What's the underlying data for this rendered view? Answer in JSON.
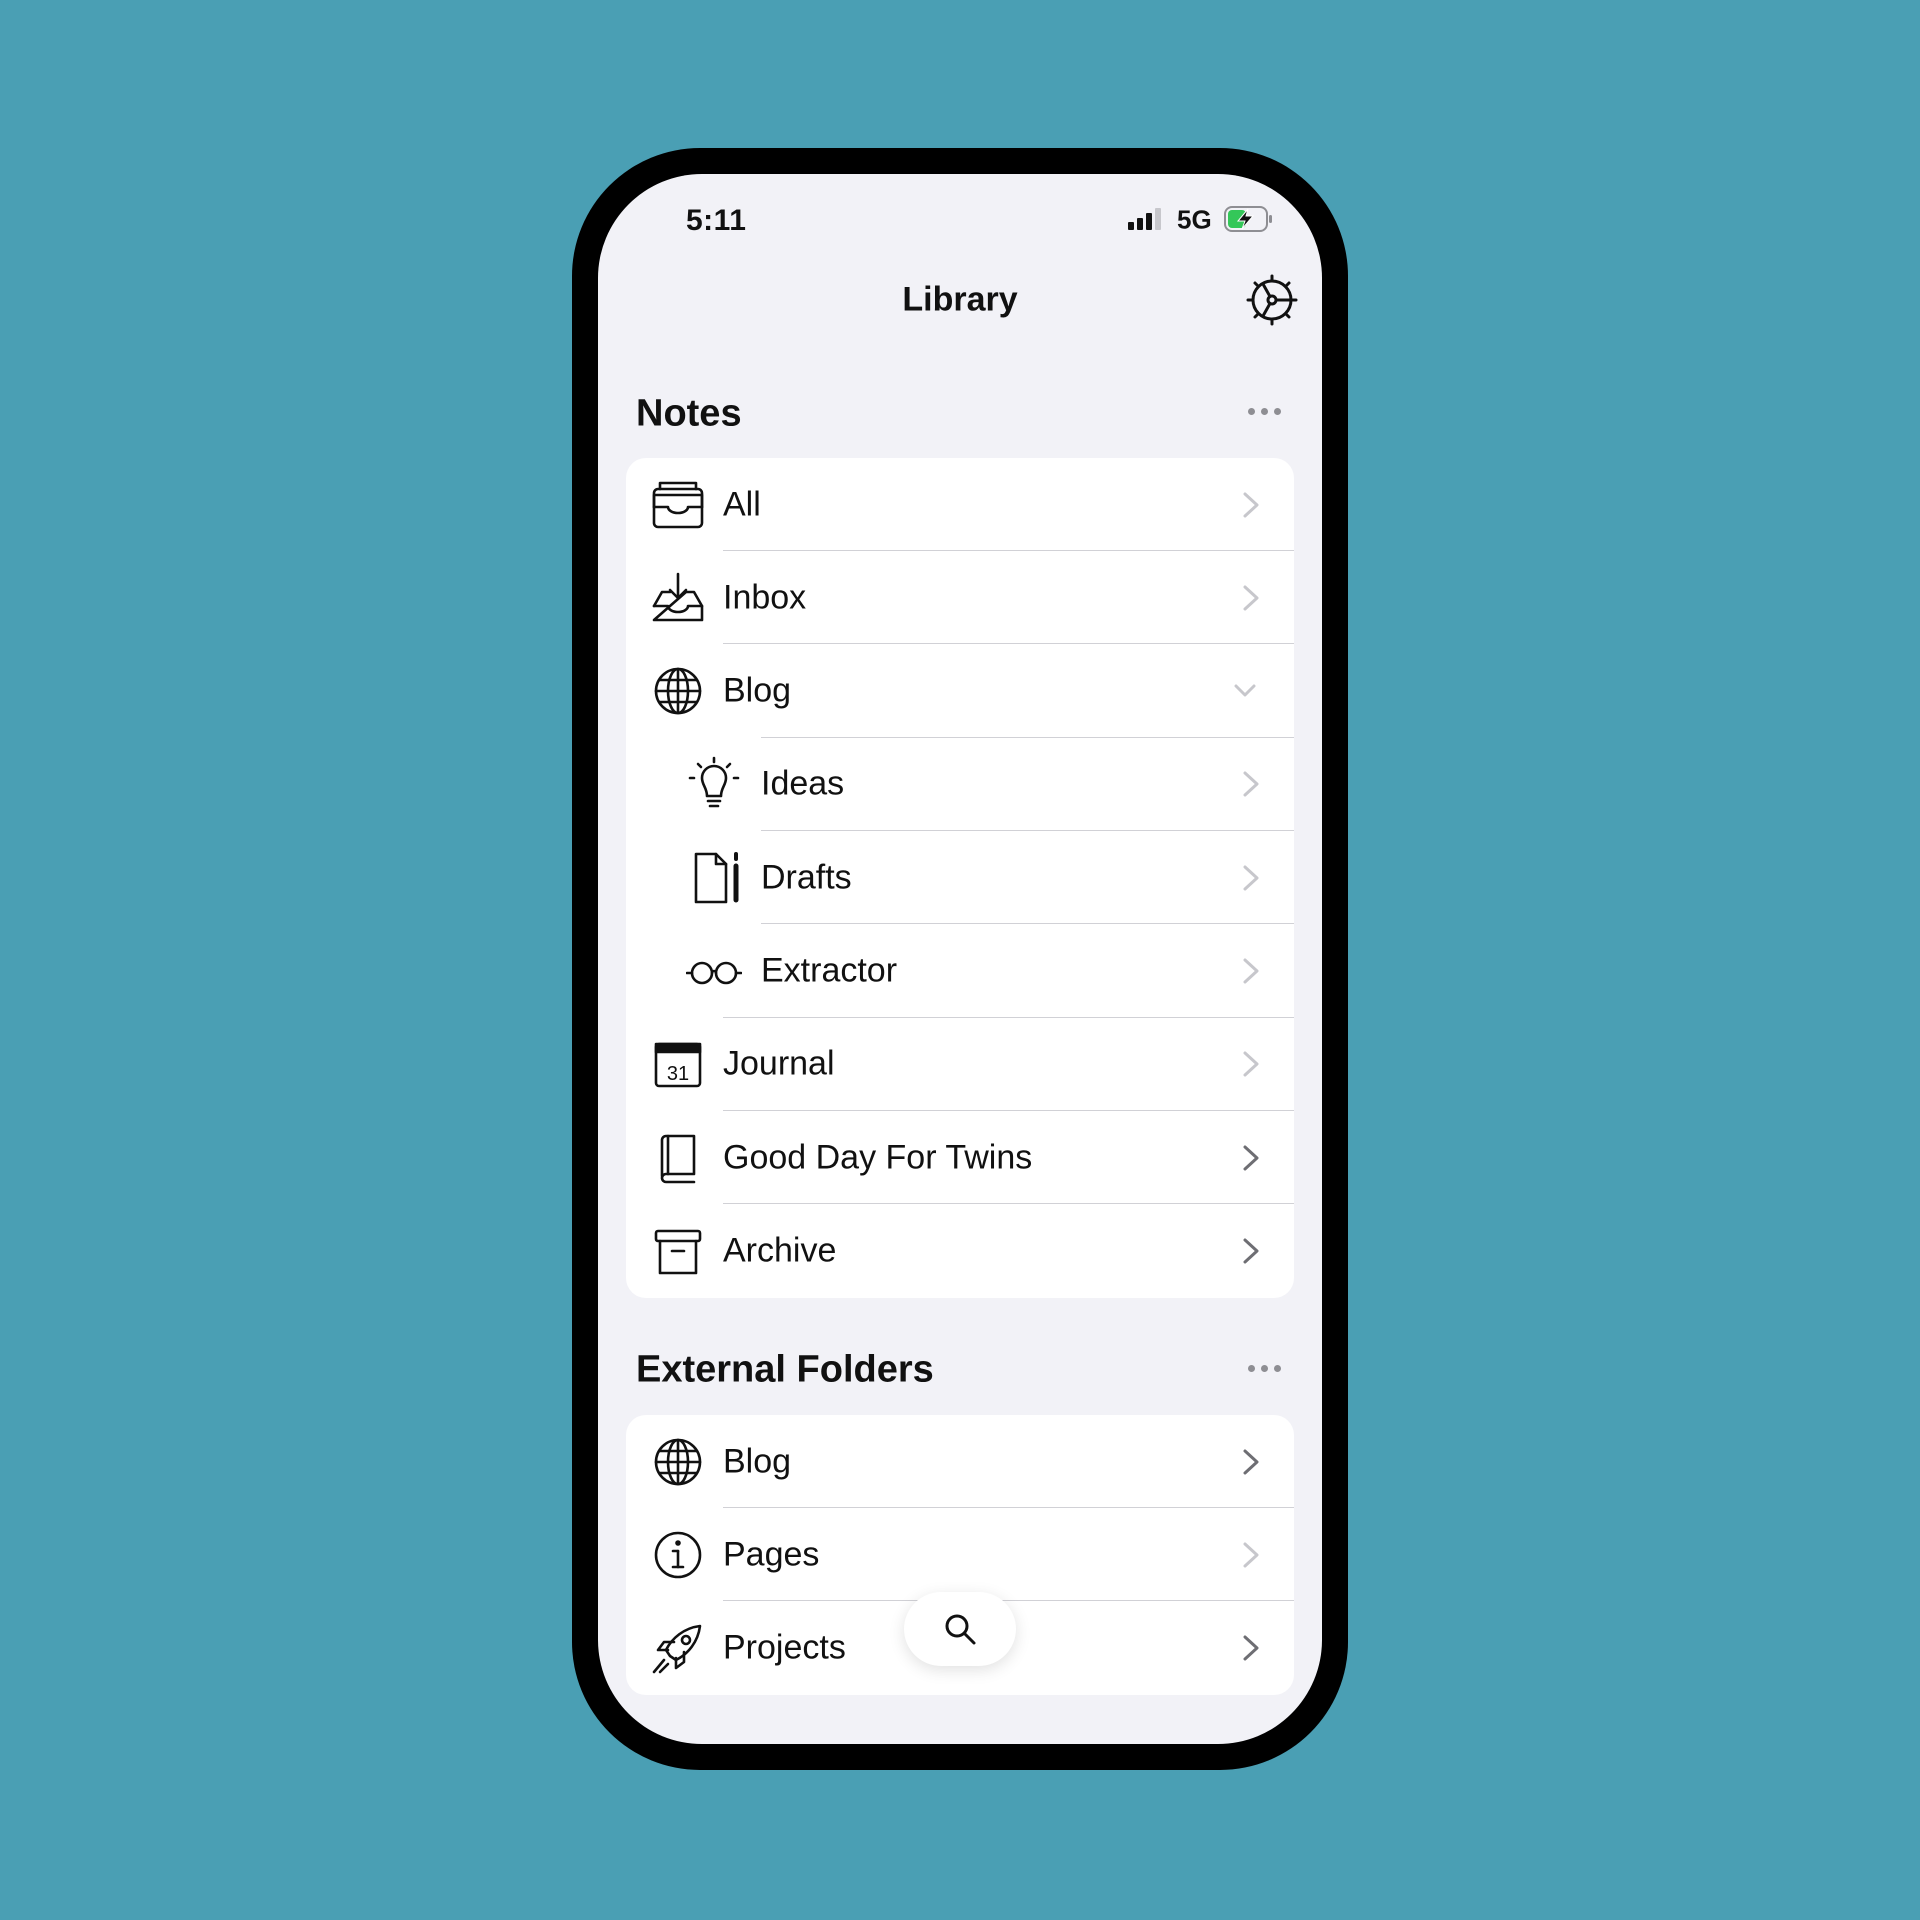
{
  "colors": {
    "background": "#4A9FB4",
    "screen": "#F2F2F7",
    "card": "#FFFFFF",
    "text": "#111111",
    "separator": "#D1D1D6",
    "chevron_muted": "#C7C7CC",
    "chevron_dark": "#6E6E73",
    "battery_green": "#34C759"
  },
  "status_bar": {
    "time": "5:11",
    "network": "5G",
    "signal_icon": "cellular-signal-icon",
    "battery_icon": "battery-charging-icon"
  },
  "nav": {
    "title": "Library",
    "settings_icon": "gear-icon"
  },
  "notes": {
    "title": "Notes",
    "more_icon": "ellipsis-icon",
    "items": [
      {
        "label": "All",
        "icon": "tray-stack-icon",
        "chevron": "right"
      },
      {
        "label": "Inbox",
        "icon": "inbox-download-icon",
        "chevron": "right"
      },
      {
        "label": "Blog",
        "icon": "globe-icon",
        "chevron": "down"
      },
      {
        "label": "Ideas",
        "icon": "lightbulb-icon",
        "chevron": "right"
      },
      {
        "label": "Drafts",
        "icon": "document-pencil-icon",
        "chevron": "right"
      },
      {
        "label": "Extractor",
        "icon": "eyeglasses-icon",
        "chevron": "right"
      },
      {
        "label": "Journal",
        "icon": "calendar-icon",
        "calendar_day": "31",
        "chevron": "right"
      },
      {
        "label": "Good Day For Twins",
        "icon": "book-icon",
        "chevron": "right"
      },
      {
        "label": "Archive",
        "icon": "archive-box-icon",
        "chevron": "right"
      }
    ]
  },
  "external": {
    "title": "External Folders",
    "more_icon": "ellipsis-icon",
    "items": [
      {
        "label": "Blog",
        "icon": "globe-icon",
        "chevron": "right"
      },
      {
        "label": "Pages",
        "icon": "info-circle-icon",
        "chevron": "right"
      },
      {
        "label": "Projects",
        "icon": "rocket-icon",
        "chevron": "right"
      }
    ]
  },
  "search": {
    "icon": "magnifying-glass-icon"
  }
}
